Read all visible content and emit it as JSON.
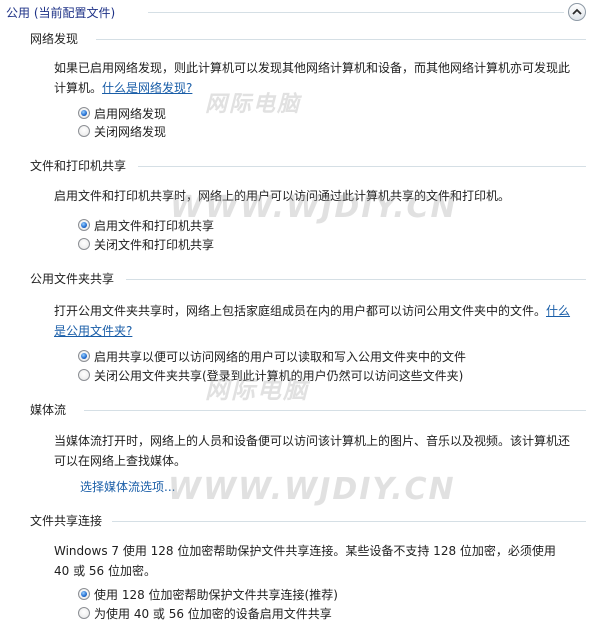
{
  "header": {
    "title": "公用 (当前配置文件)"
  },
  "sections": [
    {
      "title": "网络发现",
      "description": "如果已启用网络发现，则此计算机可以发现其他网络计算机和设备，而其他网络计算机亦可发现此计算机。",
      "link": "什么是网络发现?",
      "options": [
        {
          "label": "启用网络发现",
          "checked": true
        },
        {
          "label": "关闭网络发现",
          "checked": false
        }
      ]
    },
    {
      "title": "文件和打印机共享",
      "description": "启用文件和打印机共享时，网络上的用户可以访问通过此计算机共享的文件和打印机。",
      "options": [
        {
          "label": "启用文件和打印机共享",
          "checked": true
        },
        {
          "label": "关闭文件和打印机共享",
          "checked": false
        }
      ]
    },
    {
      "title": "公用文件夹共享",
      "description": "打开公用文件夹共享时，网络上包括家庭组成员在内的用户都可以访问公用文件夹中的文件。",
      "link": "什么是公用文件夹?",
      "options": [
        {
          "label": "启用共享以便可以访问网络的用户可以读取和写入公用文件夹中的文件",
          "checked": true
        },
        {
          "label": "关闭公用文件夹共享(登录到此计算机的用户仍然可以访问这些文件夹)",
          "checked": false
        }
      ]
    },
    {
      "title": "媒体流",
      "description": "当媒体流打开时，网络上的人员和设备便可以访问该计算机上的图片、音乐以及视频。该计算机还可以在网络上查找媒体。",
      "link": "选择媒体流选项..."
    },
    {
      "title": "文件共享连接",
      "description": "Windows 7 使用 128 位加密帮助保护文件共享连接。某些设备不支持 128 位加密，必须使用 40 或 56 位加密。",
      "options": [
        {
          "label": "使用 128 位加密帮助保护文件共享连接(推荐)",
          "checked": true
        },
        {
          "label": "为使用 40 或 56 位加密的设备启用文件共享",
          "checked": false
        }
      ]
    }
  ],
  "watermarks": [
    "网际电脑",
    "WWW.WJDIY.CN",
    "网际电脑",
    "WWW.WJDIY.CN"
  ],
  "colors": {
    "link": "#1a5ea8",
    "header_text": "#1e3287",
    "rule": "#d5dfe5"
  }
}
